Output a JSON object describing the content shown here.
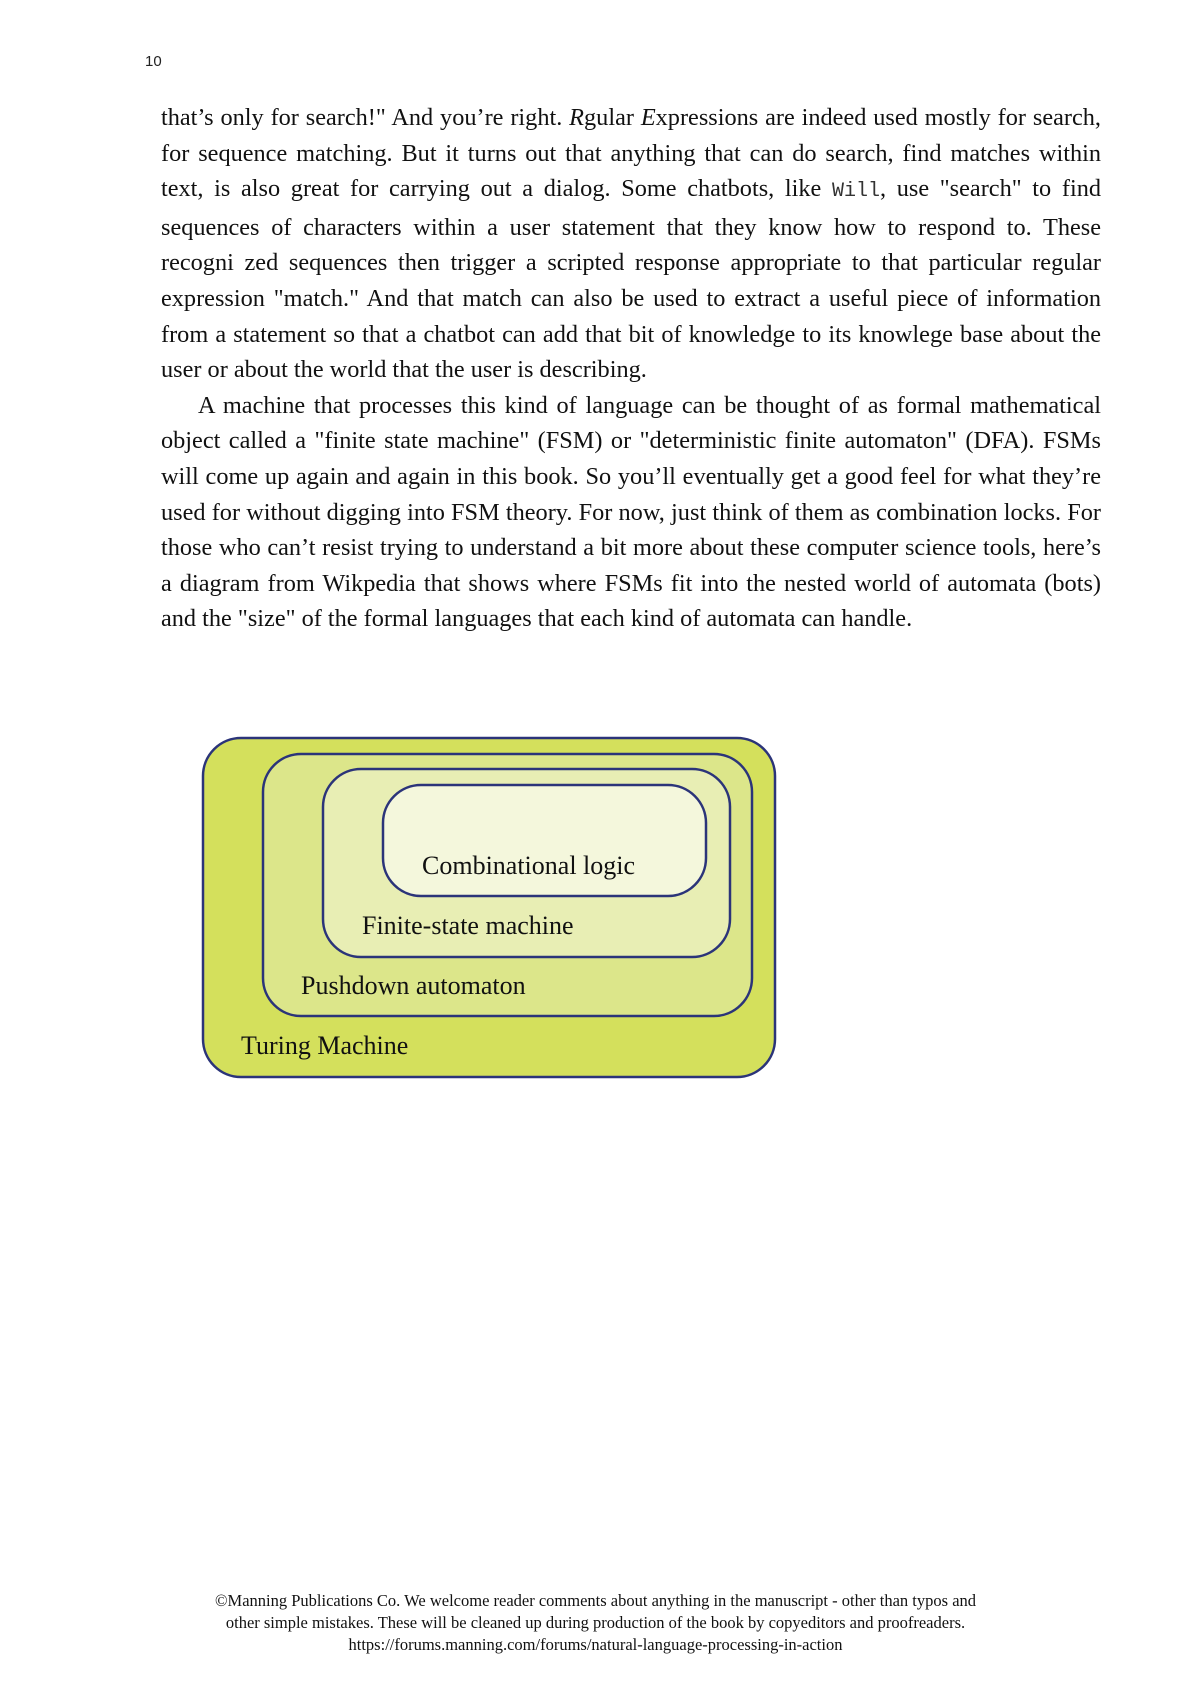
{
  "page": {
    "number": "10"
  },
  "paragraphs": [
    {
      "segments": [
        {
          "text": "that’s only for search!\" And you’re right. ",
          "style": "normal"
        },
        {
          "text": "R",
          "style": "italic"
        },
        {
          "text": "gular ",
          "style": "normal"
        },
        {
          "text": "E",
          "style": "italic"
        },
        {
          "text": "xpressions are indeed used mostly for search, for sequence matching. But it turns out that anything that can do search, find matches within text, is also great for carrying out a dialog. Some chatbots, like ",
          "style": "normal"
        },
        {
          "text": "Will",
          "style": "code"
        },
        {
          "text": ", use \"search\" to find sequences of characters within a user statement that they know how to respond to. These recogni zed sequences then trigger a scripted response appropriate to that particular regular expression \"match.\" And that match can also be used to extract a useful piece of information from a statement so that a chatbot can add that bit of knowledge to its knowlege base about the user or about the world that the user is describing.",
          "style": "normal"
        }
      ]
    },
    {
      "segments": [
        {
          "text": "A machine that processes this kind of language can be thought of as formal mathematical object called a \"finite state machine\" (FSM) or \"deterministic finite automaton\" (DFA). FSMs will come up again and again in this book. So you’ll eventually get a good feel for what they’re used for without digging into FSM theory. For now, just think of them as combination locks. For those who can’t resist trying to understand a bit more about these computer science tools, here’s a diagram from Wikpedia that shows where FSMs fit into the nested world of automata (bots) and the \"size\" of the formal languages that each kind of automata can handle.",
          "style": "normal"
        }
      ]
    }
  ],
  "diagram": {
    "stroke_color": "#2b3479",
    "levels": [
      {
        "label": "Turing Machine",
        "fill": "#d4e05c"
      },
      {
        "label": "Pushdown automaton",
        "fill": "#dce68a"
      },
      {
        "label": "Finite-state machine",
        "fill": "#e8eeb4"
      },
      {
        "label": "Combinational logic",
        "fill": "#f4f7dc"
      }
    ]
  },
  "footer": {
    "line1": "©Manning Publications Co. We welcome reader comments about anything in the manuscript - other than typos and",
    "line2": "other simple mistakes. These will be cleaned up during production of the book by copyeditors and proofreaders.",
    "line3": "https://forums.manning.com/forums/natural-language-processing-in-action"
  }
}
